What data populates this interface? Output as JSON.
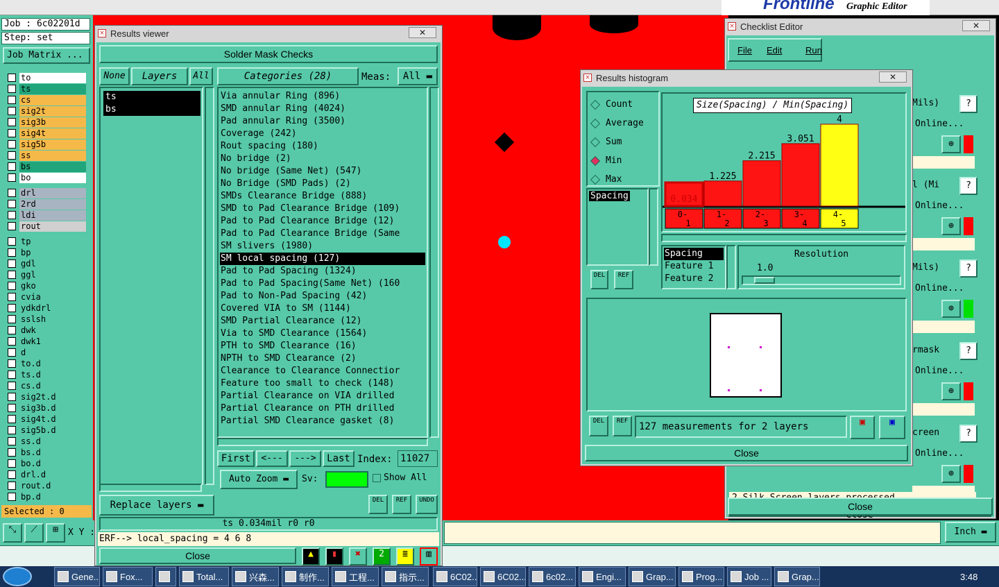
{
  "top": {
    "job": "Job : 6c02201d",
    "step": "Step: set",
    "job_matrix": "Job Matrix ...",
    "brand": "Frontline",
    "graphic_editor": "Graphic Editor"
  },
  "layers": {
    "groups": [
      [
        {
          "name": "to",
          "color": "#ffffff"
        },
        {
          "name": "ts",
          "color": "#21a57a"
        },
        {
          "name": "cs",
          "color": "#f5b94a"
        },
        {
          "name": "sig2t",
          "color": "#f5b94a"
        },
        {
          "name": "sig3b",
          "color": "#f5b94a"
        },
        {
          "name": "sig4t",
          "color": "#f5b94a"
        },
        {
          "name": "sig5b",
          "color": "#f5b94a"
        },
        {
          "name": "ss",
          "color": "#f5b94a"
        },
        {
          "name": "bs",
          "color": "#21a57a"
        },
        {
          "name": "bo",
          "color": "#ffffff"
        }
      ],
      [
        {
          "name": "drl",
          "color": "#a9b4c2"
        },
        {
          "name": "2rd",
          "color": "#a9b4c2"
        },
        {
          "name": "ldi",
          "color": "#a9b4c2"
        },
        {
          "name": "rout",
          "color": "#d0d0d0"
        }
      ],
      [
        {
          "name": "tp",
          "color": "#57c9a8"
        },
        {
          "name": "bp",
          "color": "#57c9a8"
        },
        {
          "name": "gdl",
          "color": "#57c9a8"
        },
        {
          "name": "ggl",
          "color": "#57c9a8"
        },
        {
          "name": "gko",
          "color": "#57c9a8"
        },
        {
          "name": "cvia",
          "color": "#57c9a8"
        },
        {
          "name": "ydkdrl",
          "color": "#57c9a8"
        },
        {
          "name": "sslsh",
          "color": "#57c9a8"
        },
        {
          "name": "dwk",
          "color": "#57c9a8"
        },
        {
          "name": "dwk1",
          "color": "#57c9a8"
        },
        {
          "name": "d",
          "color": "#57c9a8"
        },
        {
          "name": "to.d",
          "color": "#57c9a8"
        },
        {
          "name": "ts.d",
          "color": "#57c9a8"
        },
        {
          "name": "cs.d",
          "color": "#57c9a8"
        },
        {
          "name": "sig2t.d",
          "color": "#57c9a8"
        },
        {
          "name": "sig3b.d",
          "color": "#57c9a8"
        },
        {
          "name": "sig4t.d",
          "color": "#57c9a8"
        },
        {
          "name": "sig5b.d",
          "color": "#57c9a8"
        },
        {
          "name": "ss.d",
          "color": "#57c9a8"
        },
        {
          "name": "bs.d",
          "color": "#57c9a8"
        },
        {
          "name": "bo.d",
          "color": "#57c9a8"
        },
        {
          "name": "drl.d",
          "color": "#57c9a8"
        },
        {
          "name": "rout.d",
          "color": "#57c9a8"
        },
        {
          "name": "bp.d",
          "color": "#57c9a8"
        }
      ]
    ],
    "selected_count": "Selected : 0"
  },
  "results_viewer": {
    "title": "Results viewer",
    "header": "Solder Mask Checks",
    "none_btn": "None",
    "layers_btn": "Layers",
    "all_btn": "All",
    "layer_list": [
      "ts",
      "bs"
    ],
    "categories_label": "Categories (28)",
    "meas_label": "Meas:",
    "meas_value": "All",
    "categories": [
      "Via annular Ring (896)",
      "SMD annular Ring (4024)",
      "Pad annular Ring (3500)",
      "Coverage (242)",
      "Rout spacing (180)",
      "No bridge (2)",
      "No bridge (Same Net) (547)",
      "No Bridge (SMD Pads) (2)",
      "SMDs Clearance Bridge (888)",
      "SMD to Pad Clearance Bridge (109)",
      "Pad to Pad Clearance Bridge (12)",
      "Pad to Pad Clearance Bridge (Same",
      "SM slivers (1980)",
      "SM local spacing (127)",
      "Pad to Pad Spacing (1324)",
      "Pad to Pad Spacing(Same Net) (160",
      "Pad to Non-Pad Spacing (42)",
      "Covered VIA to SM (1144)",
      "SMD Partial Clearance (12)",
      "Via to SMD Clearance (1564)",
      "PTH to SMD Clearance (16)",
      "NPTH to SMD Clearance (2)",
      "Clearance to Clearance Connectior",
      "Feature too small to check (148)",
      "Partial Clearance on VIA drilled",
      "Partial Clearance on PTH drilled",
      "Partial SMD Clearance gasket (8)"
    ],
    "selected_category_index": 13,
    "first_btn": "First",
    "prev_btn": "<---",
    "next_btn": "--->",
    "last_btn": "Last",
    "index_label": "Index:",
    "index_value": "11027",
    "auto_zoom": "Auto Zoom",
    "sv_label": "Sv:",
    "show_all": "Show All",
    "replace_layers": "Replace layers",
    "status": "ts 0.034mil  r0  r0",
    "erf": "ERF--> local_spacing = 4 6 8",
    "close": "Close",
    "del": "DEL",
    "ref": "REF",
    "undo": "UNDO"
  },
  "histogram": {
    "title": "Results histogram",
    "modes": [
      "Count",
      "Average",
      "Sum",
      "Min",
      "Max"
    ],
    "selected_mode": "Min",
    "attribute": "Spacing",
    "chart_title": "Size(Spacing) / Min(Spacing)",
    "chart_data": {
      "type": "bar",
      "title": "Size(Spacing) / Min(Spacing)",
      "categories": [
        "0-1",
        "1-2",
        "2-3",
        "3-4",
        "4-5"
      ],
      "values": [
        0.034,
        1.225,
        2.215,
        3.051,
        4
      ],
      "value_labels": [
        "0.034",
        "1.225",
        "2.215",
        "3.051",
        "4"
      ],
      "colors": [
        "#ff1414",
        "#ff1414",
        "#ff1414",
        "#ff1414",
        "#ffff14"
      ],
      "ylim": [
        0,
        4
      ]
    },
    "bin_labels": [
      [
        "0-",
        "1"
      ],
      [
        "1-",
        "2"
      ],
      [
        "2-",
        "3"
      ],
      [
        "3-",
        "4"
      ],
      [
        "4-",
        "5"
      ]
    ],
    "spacing_list": [
      "Spacing",
      "Feature 1",
      "Feature 2"
    ],
    "resolution_label": "Resolution",
    "resolution_value": "1.0",
    "measurements": "127 measurements for 2 layers",
    "close": "Close",
    "del": "DEL",
    "ref": "REF"
  },
  "checklist": {
    "title": "Checklist Editor",
    "menu": [
      "File",
      "Edit",
      "Run"
    ],
    "right_texts": [
      "Mils)",
      "Online...",
      "l (Mi",
      "Online...",
      "Mils)",
      "Online...",
      "sed",
      "rmask",
      "Online...",
      "cessed",
      "creen",
      "Online..."
    ],
    "last_line": "2 Silk Screen layers processed",
    "close": "Close"
  },
  "bottom": {
    "xy_label": "X Y :",
    "units": "Inch",
    "close": "Close"
  },
  "taskbar": {
    "items": [
      "Gene...",
      "Fox...",
      "",
      "Total...",
      "兴森...",
      "制作...",
      "工程...",
      "指示...",
      "6C02...",
      "6C02...",
      "6c02...",
      "Engi...",
      "Grap...",
      "Prog...",
      "Job ...",
      "Grap..."
    ],
    "time": "3:48"
  }
}
